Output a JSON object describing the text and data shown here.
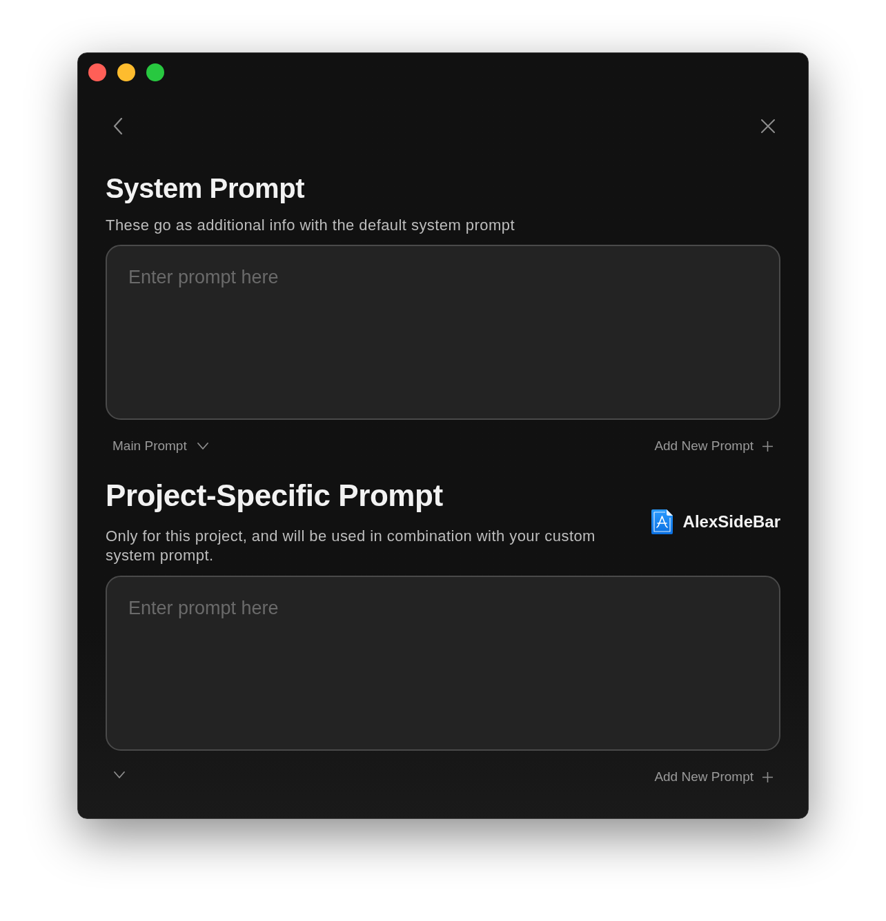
{
  "window": {
    "controls": [
      {
        "color": "#ff5f57"
      },
      {
        "color": "#febc2e"
      },
      {
        "color": "#28c840"
      }
    ]
  },
  "sections": [
    {
      "title": "System Prompt",
      "description": "These go as additional info with the default system prompt",
      "input": {
        "placeholder": "Enter prompt here"
      },
      "selector": {
        "label": "Main Prompt",
        "expanded": false
      },
      "add_button": {
        "label": "Add New Prompt"
      }
    },
    {
      "title": "Project-Specific Prompt",
      "description": "Only for this project, and will be used in combination with your custom system prompt.",
      "project": {
        "name": "AlexSideBar"
      },
      "input": {
        "placeholder": "Enter prompt here"
      },
      "selector": {
        "expanded": false
      },
      "add_button": {
        "label": "Add New Prompt"
      }
    }
  ]
}
